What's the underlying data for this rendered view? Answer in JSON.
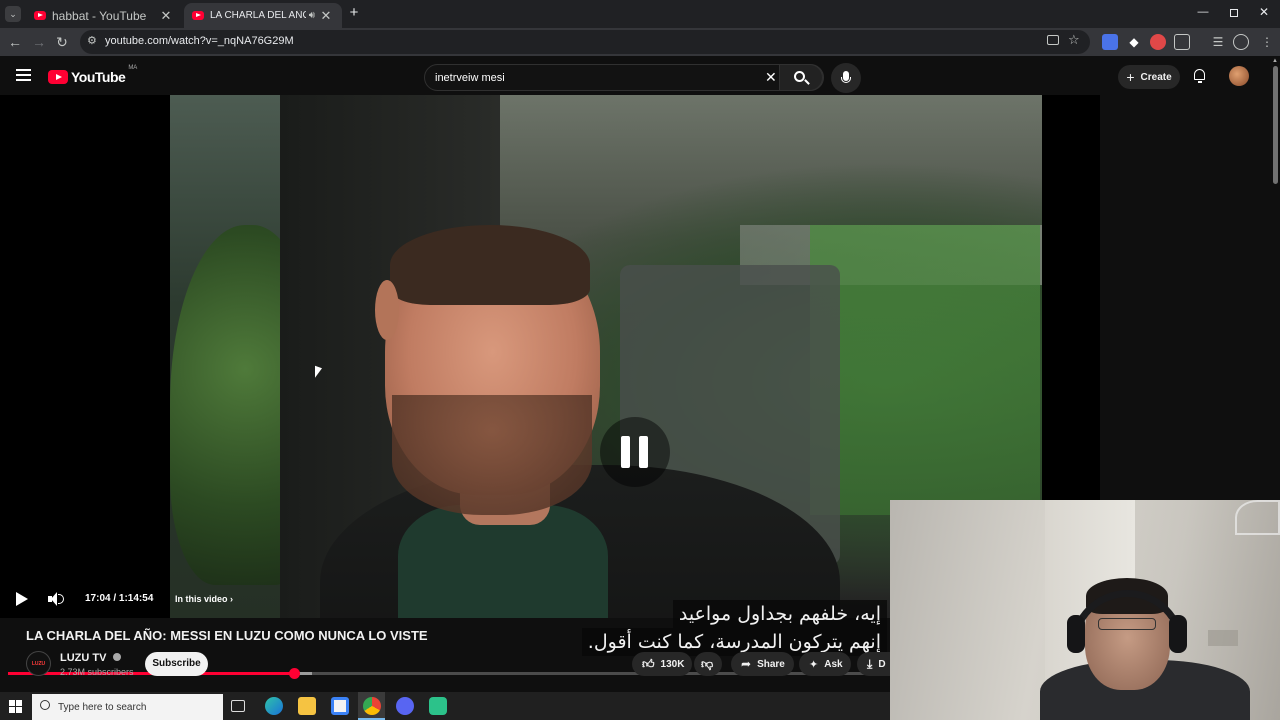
{
  "browser": {
    "tabs": [
      {
        "title": "habbat - YouTube",
        "active": false
      },
      {
        "title": "LA CHARLA DEL AÑO: MES",
        "active": true
      }
    ],
    "url": "youtube.com/watch?v=_nqNA76G29M"
  },
  "youtube": {
    "logo_text": "YouTube",
    "region": "MA",
    "search_query": "inetrveiw mesi",
    "create_label": "Create"
  },
  "player": {
    "subtitle_lines": [
      "إيه، خلفهم بجداول مواعيد",
      "إنهم يتركون المدرسة، كما كنت أقول."
    ],
    "time_current": "17:04",
    "time_total": "1:14:54",
    "time_display": "17:04 / 1:14:54",
    "in_this_video": "In this video",
    "progress_fraction": 0.326,
    "state": "playing"
  },
  "video": {
    "title": "LA CHARLA DEL AÑO: MESSI EN LUZU COMO NUNCA LO VISTE",
    "channel": "LUZU TV",
    "channel_logo_text": "LUZU",
    "subscribers": "2.73M subscribers",
    "subscribe_label": "Subscribe",
    "likes": "130K",
    "share_label": "Share",
    "ask_label": "Ask",
    "download_label": "D"
  },
  "taskbar": {
    "search_placeholder": "Type here to search"
  },
  "colors": {
    "brand_red": "#ff0033",
    "background": "#0f0f0f",
    "chrome_dark": "#202124"
  }
}
